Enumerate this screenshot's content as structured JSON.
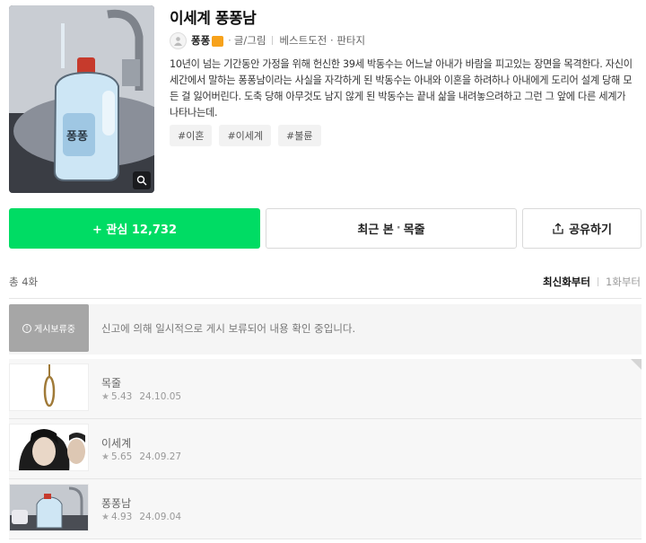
{
  "header": {
    "title": "이세계 퐁퐁남",
    "author": "퐁퐁",
    "role": "글/그림",
    "meta_separator": "·",
    "genre": "베스트도전 · 판타지",
    "description": "10년이 넘는 기간동안 가정을 위해 헌신한 39세 박동수는 어느날 아내가 바람을 피고있는 장면을 목격한다. 자신이 세간에서 말하는 퐁퐁남이라는 사실을 자각하게 된 박동수는 아내와 이혼을 하려하나 아내에게 도리어 설계 당해 모든 걸 잃어버린다. 도축 당해 아무것도 남지 않게 된 박동수는 끝내 삶을 내려놓으려하고 그런 그 앞에 다른 세계가 나타나는데.",
    "tags": [
      "#이혼",
      "#이세계",
      "#불륜"
    ],
    "cover_label": "퐁퐁"
  },
  "actions": {
    "favorite": "+ 관심 12,732",
    "recent_prefix": "최근 본",
    "recent_sep": "·",
    "recent_episode": "목줄",
    "share": "공유하기"
  },
  "list": {
    "total": "총 4화",
    "sort_newest": "최신화부터",
    "sort_first": "1화부터",
    "hold": {
      "badge": "게시보류중",
      "message": "신고에 의해 일시적으로 게시 보류되어 내용 확인 중입니다."
    },
    "episodes": [
      {
        "title": "목줄",
        "rating": "5.43",
        "date": "24.10.05"
      },
      {
        "title": "이세계",
        "rating": "5.65",
        "date": "24.09.27"
      },
      {
        "title": "퐁퐁남",
        "rating": "4.93",
        "date": "24.09.04"
      }
    ]
  },
  "colors": {
    "accent": "#00dc64",
    "hold_badge": "#a6a6a6"
  },
  "icons": {
    "zoom": "magnifier-icon",
    "share": "share-icon",
    "star": "star-icon",
    "info": "info-circle-icon"
  }
}
